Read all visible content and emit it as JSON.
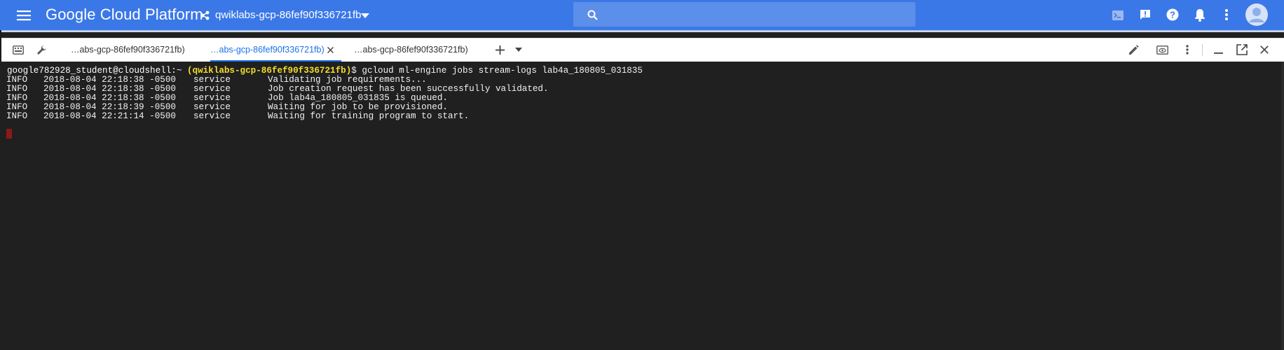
{
  "header": {
    "brand": "Google Cloud Platform",
    "project": "qwiklabs-gcp-86fef90f336721fb",
    "colors": {
      "bar": "#3b78e7",
      "search": "#5c8fea"
    },
    "icons": [
      "menu-icon",
      "project-icon",
      "dropdown-icon",
      "search-icon",
      "cloud-shell-icon",
      "feedback-icon",
      "help-icon",
      "notifications-icon",
      "more-vert-icon",
      "account-avatar-icon"
    ]
  },
  "shell_tabs": {
    "tabs": [
      {
        "label": "…abs-gcp-86fef90f336721fb)"
      },
      {
        "label": "…abs-gcp-86fef90f336721fb)",
        "active": true
      },
      {
        "label": "…abs-gcp-86fef90f336721fb)"
      }
    ],
    "icons": [
      "keyboard-icon",
      "wrench-icon",
      "close-icon",
      "add-tab-icon",
      "tab-dropdown-icon",
      "edit-icon",
      "web-preview-icon",
      "more-vert-icon",
      "minimize-icon",
      "open-new-window-icon",
      "close-shell-icon"
    ]
  },
  "terminal": {
    "prompt_user": "google782928_student@cloudshell:~",
    "prompt_project": "(qwiklabs-gcp-86fef90f336721fb)",
    "command": "$ gcloud ml-engine jobs stream-logs lab4a_180805_031835",
    "logs": [
      {
        "level": "INFO",
        "time": "2018-08-04 22:18:38 -0500",
        "source": "service",
        "message": "Validating job requirements..."
      },
      {
        "level": "INFO",
        "time": "2018-08-04 22:18:38 -0500",
        "source": "service",
        "message": "Job creation request has been successfully validated."
      },
      {
        "level": "INFO",
        "time": "2018-08-04 22:18:38 -0500",
        "source": "service",
        "message": "Job lab4a_180805_031835 is queued."
      },
      {
        "level": "INFO",
        "time": "2018-08-04 22:18:39 -0500",
        "source": "service",
        "message": "Waiting for job to be provisioned."
      },
      {
        "level": "INFO",
        "time": "2018-08-04 22:21:14 -0500",
        "source": "service",
        "message": "Waiting for training program to start."
      }
    ],
    "colors": {
      "background": "#202020",
      "text": "#f2f2f2",
      "project": "#f5dd2a",
      "cursor": "#8b1a1a"
    }
  }
}
